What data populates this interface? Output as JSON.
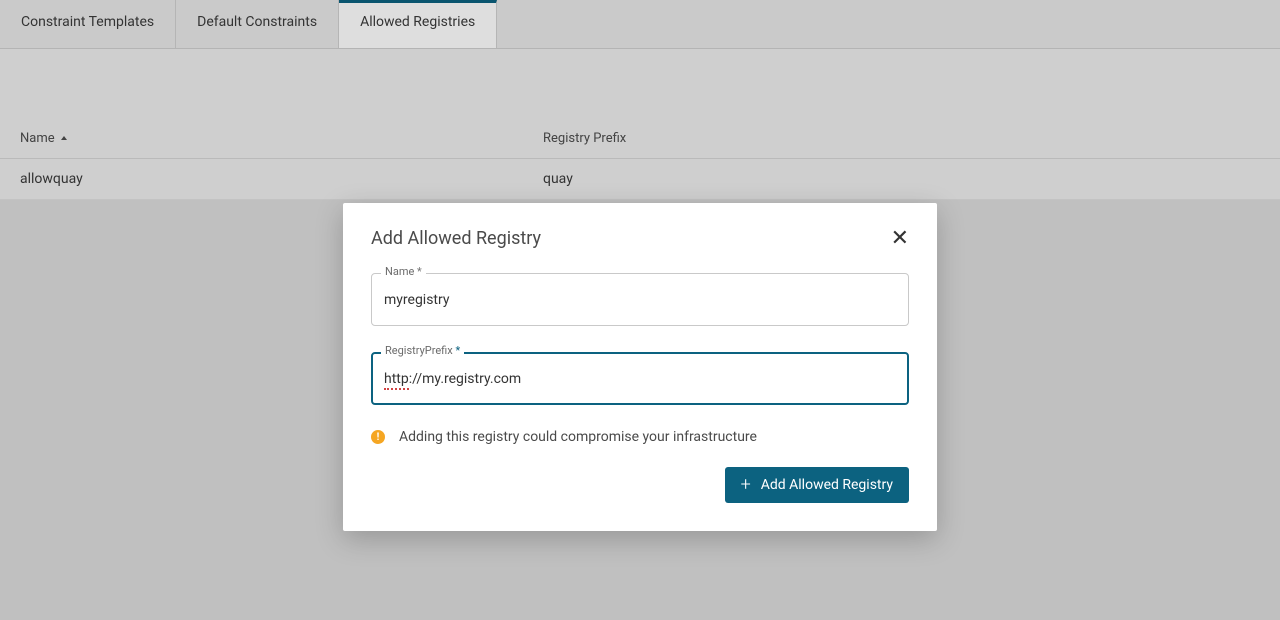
{
  "tabs": [
    {
      "label": "Constraint Templates"
    },
    {
      "label": "Default Constraints"
    },
    {
      "label": "Allowed Registries"
    }
  ],
  "table": {
    "columns": {
      "name": "Name",
      "prefix": "Registry Prefix"
    },
    "rows": [
      {
        "name": "allowquay",
        "prefix": "quay"
      }
    ]
  },
  "modal": {
    "title": "Add Allowed Registry",
    "fields": {
      "name": {
        "label": "Name",
        "required": "*",
        "value": "myregistry"
      },
      "prefix": {
        "label": "RegistryPrefix",
        "required": "*",
        "value": "http://my.registry.com"
      }
    },
    "warning": "Adding this registry could compromise your infrastructure",
    "submit": "Add Allowed Registry"
  }
}
